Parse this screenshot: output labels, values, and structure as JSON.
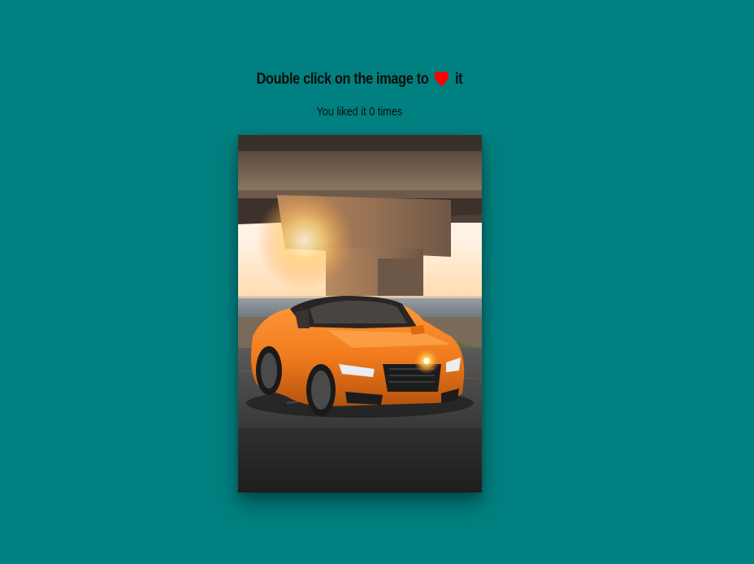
{
  "heading": {
    "before": "Double click on the image to",
    "icon": "heart-icon",
    "after": "it",
    "heart_color": "#ff0000"
  },
  "counter": {
    "prefix": "You liked it",
    "count": "0",
    "suffix": "times"
  },
  "photo": {
    "subject": "orange-sports-car-under-bridge",
    "car_color": "#f07a1c"
  },
  "colors": {
    "background": "#008080",
    "text": "#0c0c0c"
  }
}
